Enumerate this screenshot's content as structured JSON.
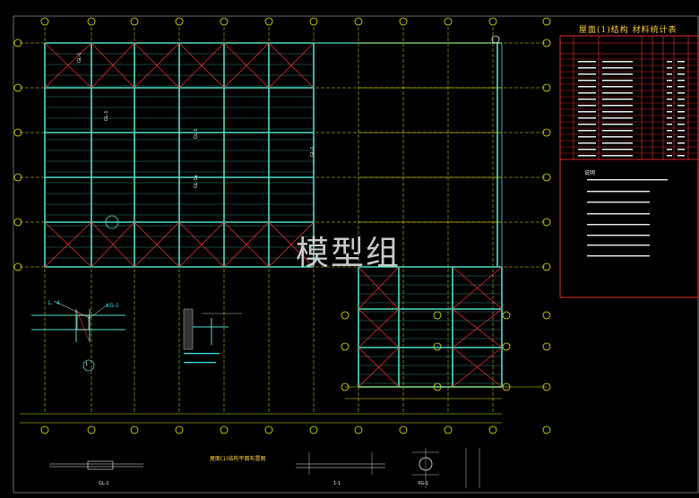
{
  "drawing": {
    "table_title": "屋面(1)结构    材料统计表",
    "watermark": "模型组",
    "notes_title": "说明",
    "plan_caption": "屋面(1)结构平面布置图",
    "section_caption_1": "1-1",
    "section_caption_2": "GL-1",
    "section_caption_3": "XG-1",
    "detail_number": "1",
    "note_label": "1、4",
    "xg_label": "XG-1",
    "rotated_labels": [
      "GL-1",
      "GL-1",
      "GL-1a",
      "GL-1",
      "GL-1"
    ]
  },
  "colors": {
    "background": "#000000",
    "grid_line": "#e8e800",
    "beam": "#4fe0c8",
    "brace": "#ff3030",
    "axis_bubble": "#e8e800",
    "text_cyan": "#34e6e6",
    "text_white": "#f0f0f0",
    "table_border": "#ff3030"
  }
}
